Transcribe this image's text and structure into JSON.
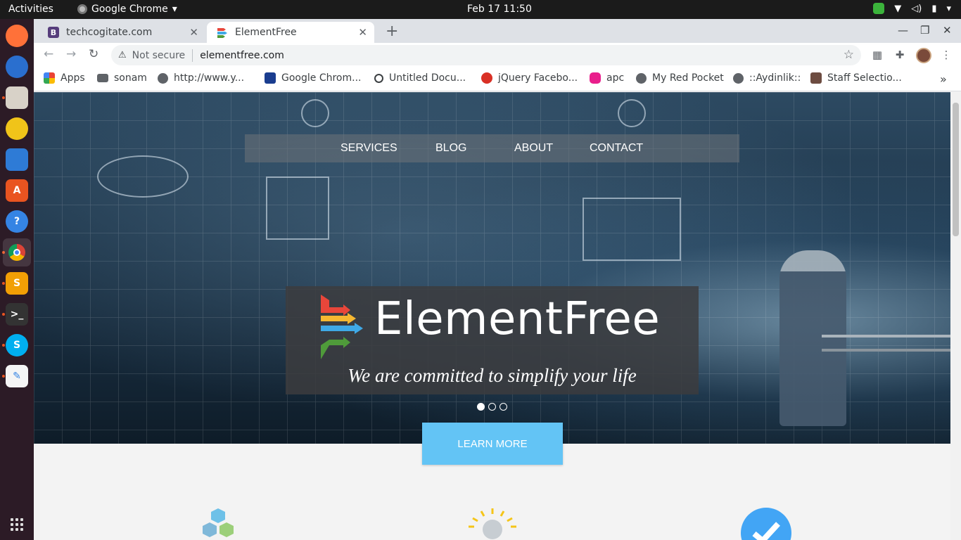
{
  "topbar": {
    "activities": "Activities",
    "app_name": "Google Chrome",
    "clock": "Feb 17  11:50"
  },
  "tabs": [
    {
      "title": "techcogitate.com",
      "favicon": "B"
    },
    {
      "title": "ElementFree"
    }
  ],
  "toolbar": {
    "security_label": "Not secure",
    "url": "elementfree.com"
  },
  "bookmarks": [
    {
      "label": "Apps"
    },
    {
      "label": "sonam"
    },
    {
      "label": "http://www.y..."
    },
    {
      "label": "Google Chrom..."
    },
    {
      "label": "Untitled Docu..."
    },
    {
      "label": "jQuery Facebo..."
    },
    {
      "label": "apc"
    },
    {
      "label": "My Red Pocket"
    },
    {
      "label": "::Aydinlik::"
    },
    {
      "label": "Staff Selectio..."
    }
  ],
  "site": {
    "nav": [
      "SERVICES",
      "BLOG",
      "ABOUT",
      "CONTACT"
    ],
    "brand": "ElementFree",
    "tagline": "We are committed to simplify your life",
    "cta": "LEARN MORE",
    "slides": {
      "count": 3,
      "active": 1
    }
  },
  "colors": {
    "cta": "#63c4f5",
    "arrow_red": "#e8463a",
    "arrow_yellow": "#f5b731",
    "arrow_blue": "#3fa9e6",
    "arrow_green": "#4f9b3a"
  }
}
